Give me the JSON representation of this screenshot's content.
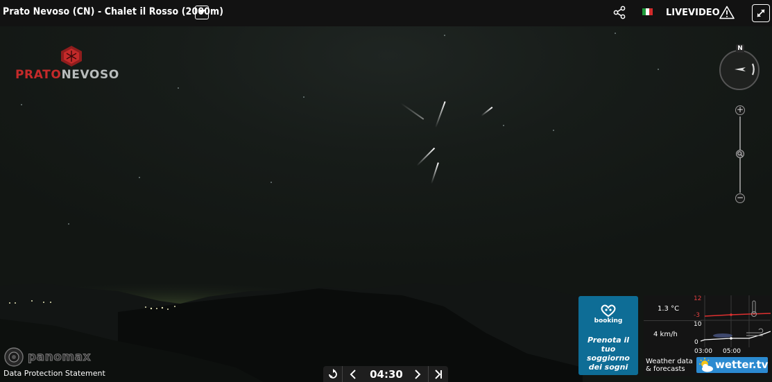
{
  "header": {
    "camera_title": "Prato Nevoso (CN) - Chalet il Rosso (2000m)",
    "language_flag": "it-flag-icon",
    "livevideo_label": "LIVEVIDEO"
  },
  "brand": {
    "logo_part1": "PRATO",
    "logo_part2": "NEVOSO",
    "color_part1": "#c42a2a",
    "color_part2": "#b8bcbc"
  },
  "compass": {
    "north_label": "N"
  },
  "zoom": {
    "plus_label": "+",
    "minus_label": "−"
  },
  "footer": {
    "panomax_label": "panomax",
    "data_protection": "Data Protection Statement"
  },
  "playback": {
    "time": "04:30"
  },
  "booking_ad": {
    "brand": "booking",
    "tagline": "Prenota il tuo soggiorno dei sogni"
  },
  "weather": {
    "temperature": "1.3 °C",
    "wind": "4 km/h",
    "temp_axis_max": "12",
    "temp_axis_min": "-3",
    "wind_axis_max": "10",
    "wind_axis_min": "0",
    "time_labels": [
      "03:00",
      "05:00"
    ],
    "footer_text_line1": "Weather data",
    "footer_text_line2": "& forecasts",
    "provider": "wetter.tv"
  }
}
